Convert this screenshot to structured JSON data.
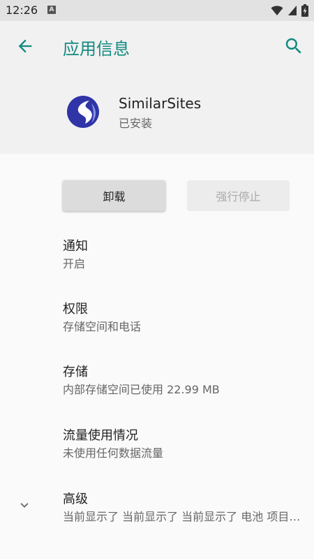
{
  "status_bar": {
    "time": "12:26",
    "notification_icon": "A"
  },
  "header": {
    "title": "应用信息",
    "back_icon": "arrow-back-icon",
    "search_icon": "search-icon"
  },
  "app": {
    "name": "SimilarSites",
    "status": "已安装"
  },
  "buttons": {
    "uninstall": "卸载",
    "force_stop": "强行停止"
  },
  "preferences": [
    {
      "title": "通知",
      "summary": "开启"
    },
    {
      "title": "权限",
      "summary": "存储空间和电话"
    },
    {
      "title": "存储",
      "summary": "内部存储空间已使用 22.99 MB"
    },
    {
      "title": "流量使用情况",
      "summary": "未使用任何数据流量"
    },
    {
      "title": "高级",
      "summary": "当前显示了 当前显示了 当前显示了 电池 项目、默认打开、…"
    }
  ],
  "colors": {
    "accent": "#128a80",
    "header_bg": "#f1f1f1",
    "status_bar_bg": "#e2e2e2"
  }
}
